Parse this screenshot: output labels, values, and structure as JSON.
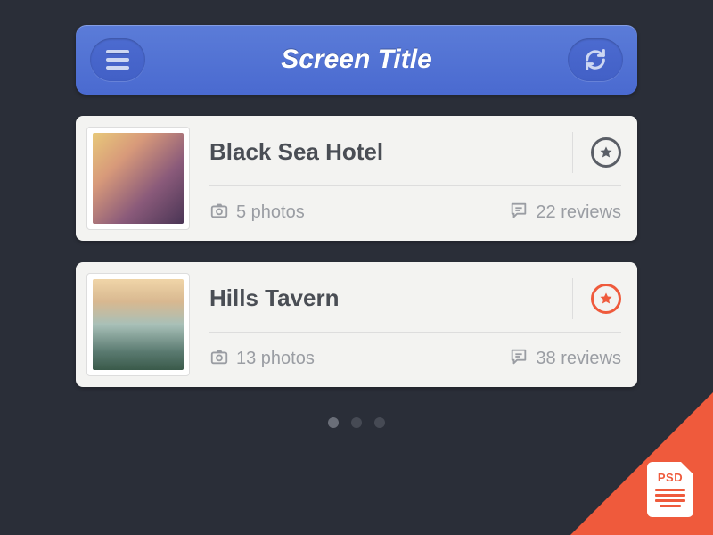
{
  "header": {
    "title": "Screen Title"
  },
  "cards": [
    {
      "title": "Black Sea Hotel",
      "photos_text": "5 photos",
      "reviews_text": "22 reviews",
      "favorited": false
    },
    {
      "title": "Hills Tavern",
      "photos_text": "13 photos",
      "reviews_text": "38 reviews",
      "favorited": true
    }
  ],
  "badge": {
    "label": "PSD"
  },
  "colors": {
    "accent": "#ef5a3c",
    "header": "#4a6ad0"
  }
}
